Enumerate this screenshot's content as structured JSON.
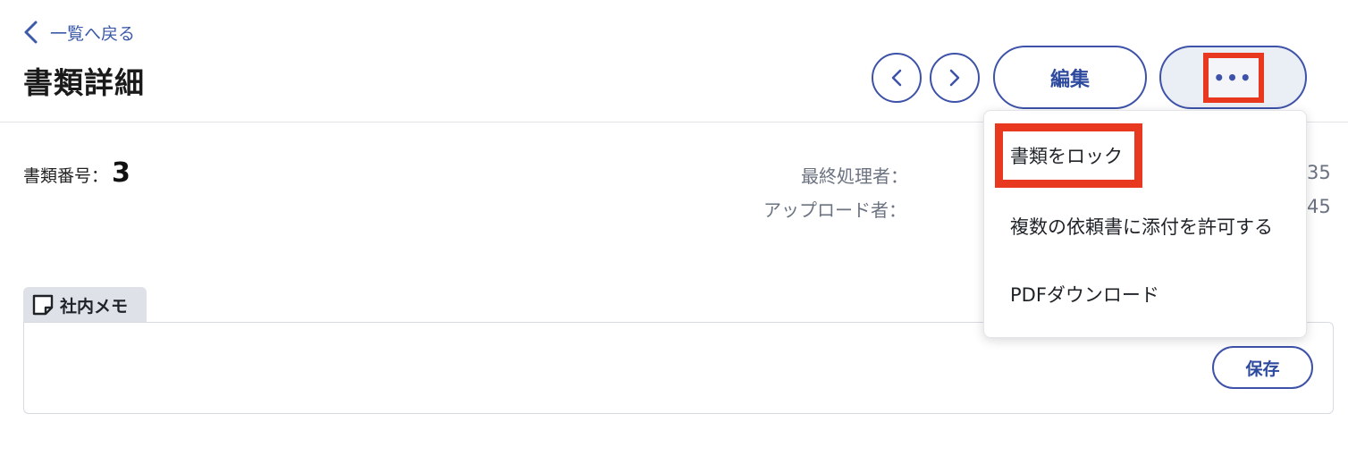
{
  "header": {
    "back_label": "一覧へ戻る",
    "title": "書類詳細",
    "edit_label": "編集",
    "more_label": "•••"
  },
  "document": {
    "number_label": "書類番号：",
    "number_value": "3",
    "last_processor_label": "最終処理者：",
    "uploader_label": "アップロード者：",
    "last_processed_time_fragment": "35",
    "uploaded_time_fragment": "45"
  },
  "memo": {
    "tab_label": "社内メモ",
    "save_label": "保存"
  },
  "dropdown": {
    "items": [
      {
        "label": "書類をロック"
      },
      {
        "label": "複数の依頼書に添付を許可する"
      },
      {
        "label": "PDFダウンロード"
      }
    ]
  },
  "colors": {
    "accent": "#3d52a8",
    "highlight": "#e8381f"
  },
  "icons": {
    "back": "chevron-left-icon",
    "prev": "chevron-left-icon",
    "next": "chevron-right-icon",
    "memo": "sticky-note-icon"
  }
}
